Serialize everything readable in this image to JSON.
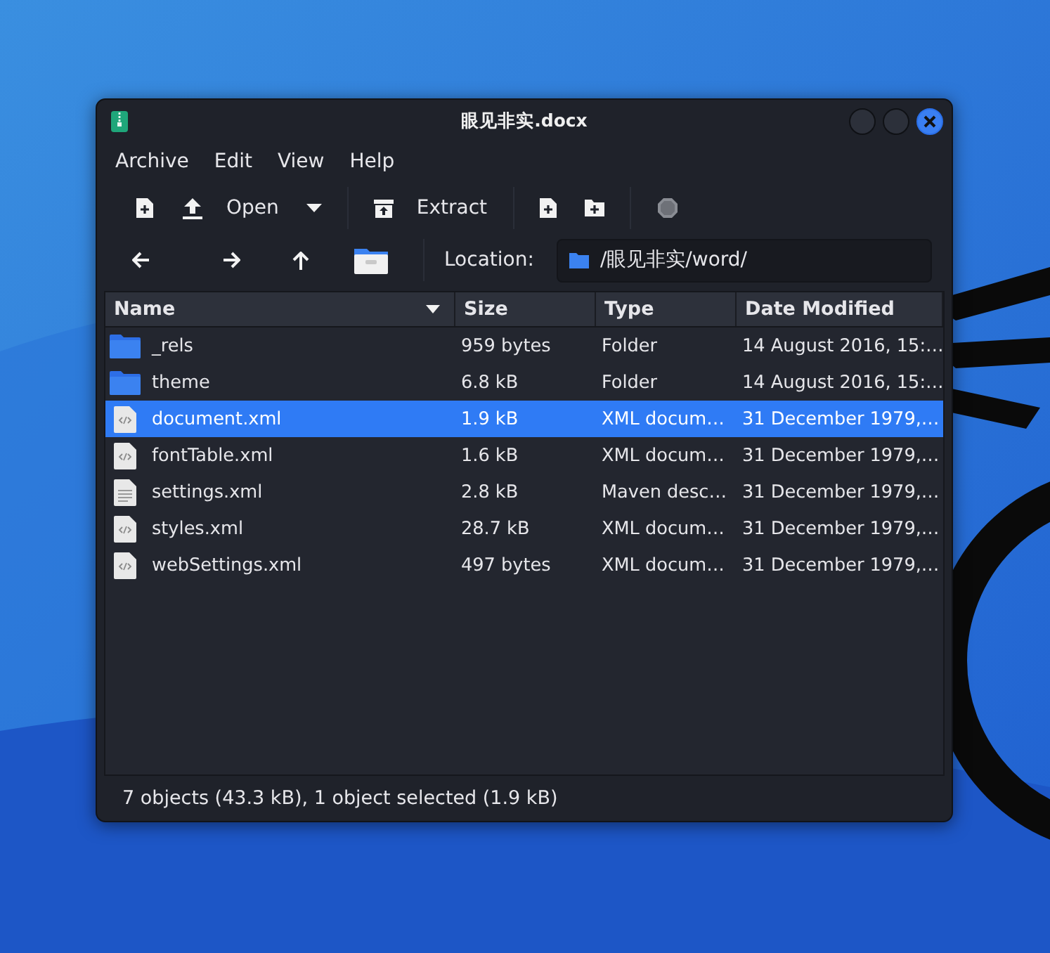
{
  "window": {
    "title": "眼见非实.docx",
    "controls": [
      {
        "kind": "minimize"
      },
      {
        "kind": "maximize"
      },
      {
        "kind": "close"
      }
    ]
  },
  "menu": [
    "Archive",
    "Edit",
    "View",
    "Help"
  ],
  "toolbar": [
    [
      {
        "kind": "new",
        "disabled": false
      },
      {
        "kind": "open",
        "label": "Open",
        "disabled": false
      },
      {
        "kind": "dropdown",
        "disabled": false
      }
    ],
    [
      {
        "kind": "extract",
        "label": "Extract",
        "disabled": false
      }
    ],
    [
      {
        "kind": "add-file",
        "disabled": false
      },
      {
        "kind": "add-folder",
        "disabled": false
      }
    ],
    [
      {
        "kind": "stop",
        "disabled": true
      }
    ]
  ],
  "navigation": [
    {
      "kind": "back"
    },
    {
      "kind": "forward"
    },
    {
      "kind": "up"
    },
    {
      "kind": "home"
    }
  ],
  "location": {
    "label": "Location:",
    "value": "/眼见非实/word/"
  },
  "table": {
    "columns": [
      {
        "label": "Name",
        "sorted": true
      },
      {
        "label": "Size",
        "sorted": false
      },
      {
        "label": "Type",
        "sorted": false
      },
      {
        "label": "Date Modified",
        "sorted": false
      }
    ],
    "rows": [
      {
        "kind": "folder",
        "name": "_rels",
        "size": "959 bytes",
        "type": "Folder",
        "date": "14 August 2016, 15:…",
        "selected": false
      },
      {
        "kind": "folder",
        "name": "theme",
        "size": "6.8 kB",
        "type": "Folder",
        "date": "14 August 2016, 15:…",
        "selected": false
      },
      {
        "kind": "xml",
        "name": "document.xml",
        "size": "1.9 kB",
        "type": "XML docum…",
        "date": "31 December 1979,…",
        "selected": true
      },
      {
        "kind": "xml",
        "name": "fontTable.xml",
        "size": "1.6 kB",
        "type": "XML docum…",
        "date": "31 December 1979,…",
        "selected": false
      },
      {
        "kind": "text",
        "name": "settings.xml",
        "size": "2.8 kB",
        "type": "Maven desc…",
        "date": "31 December 1979,…",
        "selected": false
      },
      {
        "kind": "xml",
        "name": "styles.xml",
        "size": "28.7 kB",
        "type": "XML docum…",
        "date": "31 December 1979,…",
        "selected": false
      },
      {
        "kind": "xml",
        "name": "webSettings.xml",
        "size": "497 bytes",
        "type": "XML docum…",
        "date": "31 December 1979,…",
        "selected": false
      }
    ]
  },
  "status_bar": "7 objects (43.3 kB), 1 object selected (1.9 kB)"
}
